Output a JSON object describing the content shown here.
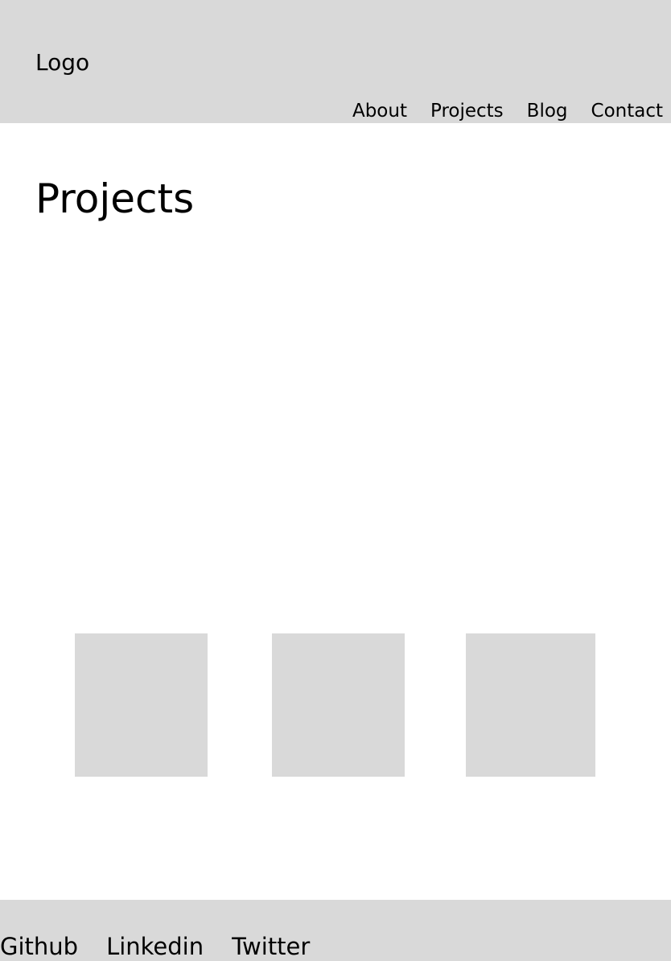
{
  "header": {
    "logo": "Logo",
    "nav": [
      "About",
      "Projects",
      "Blog",
      "Contact"
    ]
  },
  "main": {
    "title": "Projects",
    "cards": 3
  },
  "footer": {
    "links": [
      "Github",
      "Linkedin",
      "Twitter"
    ]
  },
  "colors": {
    "panel": "#d9d9d9",
    "background": "#ffffff",
    "text": "#000000"
  }
}
